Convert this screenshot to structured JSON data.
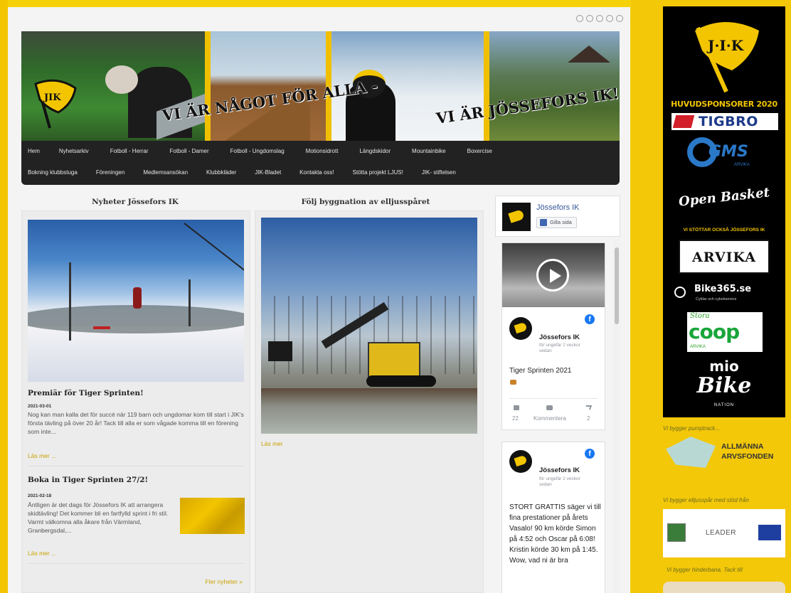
{
  "nav": {
    "row1": [
      "Hem",
      "Nyhetsarkiv",
      "Fotboll - Herrar",
      "Fotboll - Damer",
      "Fotboll - Ungdomslag",
      "Motionsidrott",
      "Längdskidor",
      "Mountainbike",
      "Boxercise"
    ],
    "row2": [
      "Bokning klubbstuga",
      "Föreningen",
      "Medlemsansökan",
      "Klubbkläder",
      "JIK-Bladet",
      "Kontakta oss!",
      "Stötta projekt LJUS!",
      "JIK- stiftelsen"
    ]
  },
  "banner": {
    "text_left": "VI ÄR NÅGOT FÖR ALLA -",
    "text_right": "VI ÄR JÖSSEFORS IK!",
    "logo_text": "JIK"
  },
  "news": {
    "heading": "Nyheter Jössefors IK",
    "items": [
      {
        "title": "Premiär för Tiger Sprinten!",
        "date": "2021-03-01",
        "body": "Nog kan man kalla det för succé när 119 barn och ungdomar kom till start i JIK's första tävling på över 20 år! Tack till alla er som vågade komma till en förening som inte...",
        "readmore": "Läs mer ..."
      },
      {
        "title": "Boka in Tiger Sprinten 27/2!",
        "date": "2021-02-18",
        "body": "Äntligen är det dags för Jössefors IK att arrangera skidtävling! Det kommer bli en fartfylld sprint i fri stil. Varmt välkomna alla åkare från Värmland, Granbergsdal,...",
        "readmore": "Läs mer ..."
      }
    ],
    "more": "Fler nyheter »"
  },
  "build": {
    "heading": "Följ byggnation av elljusspåret",
    "readmore": "Läs mer"
  },
  "fb": {
    "page_name": "Jössefors IK",
    "like_label": "Gilla sida",
    "post1": {
      "author": "Jössefors IK",
      "time": "för ungefär 2 veckor sedan",
      "text": "Tiger Sprinten 2021",
      "likes": "22",
      "comment_label": "Kommentera",
      "shares": "2"
    },
    "post2": {
      "author": "Jössefors IK",
      "time": "för ungefär 2 veckor sedan",
      "text": "STORT GRATTIS säger vi till fina prestationer på årets Vasalo! 90 km körde Simon på 4:52 och Oscar på 6:08! Kristin körde 30 km på 1:45. Wow, vad ni är bra"
    }
  },
  "sponsors": {
    "logo_text": "J·I·K",
    "main_heading": "HUVUDSPONSORER 2020",
    "tigbro": "TIGBRO",
    "gms": "GMS",
    "gms_sub": "ARVIKA",
    "open_basket": "Open Basket",
    "support_heading": "VI STÖTTAR OCKSÅ JÖSSEFORS IK",
    "arvika": "ARVIKA",
    "bike365": "Bike365.se",
    "bike365_sub": "Cyklar och cykelservice",
    "coop_top": "Stora",
    "coop": "coop",
    "coop_sub": "ARVIKA",
    "mio": "mio",
    "bike": "Bike",
    "bike_sub": "NATION"
  },
  "side": {
    "caption1": "Vi bygger pumptrack...",
    "arvs_line1": "ALLMÄNNA",
    "arvs_line2": "ARVSFONDEN",
    "caption2": "Vi bygger elljusspår med stöd från",
    "leader": "LEADER",
    "caption3": "Vi bygger hinderbana. Tack till"
  },
  "colors": {
    "brand_yellow": "#f2c500",
    "nav_bg": "#222222",
    "readmore": "#c9a200",
    "fb_blue": "#1877f2"
  }
}
